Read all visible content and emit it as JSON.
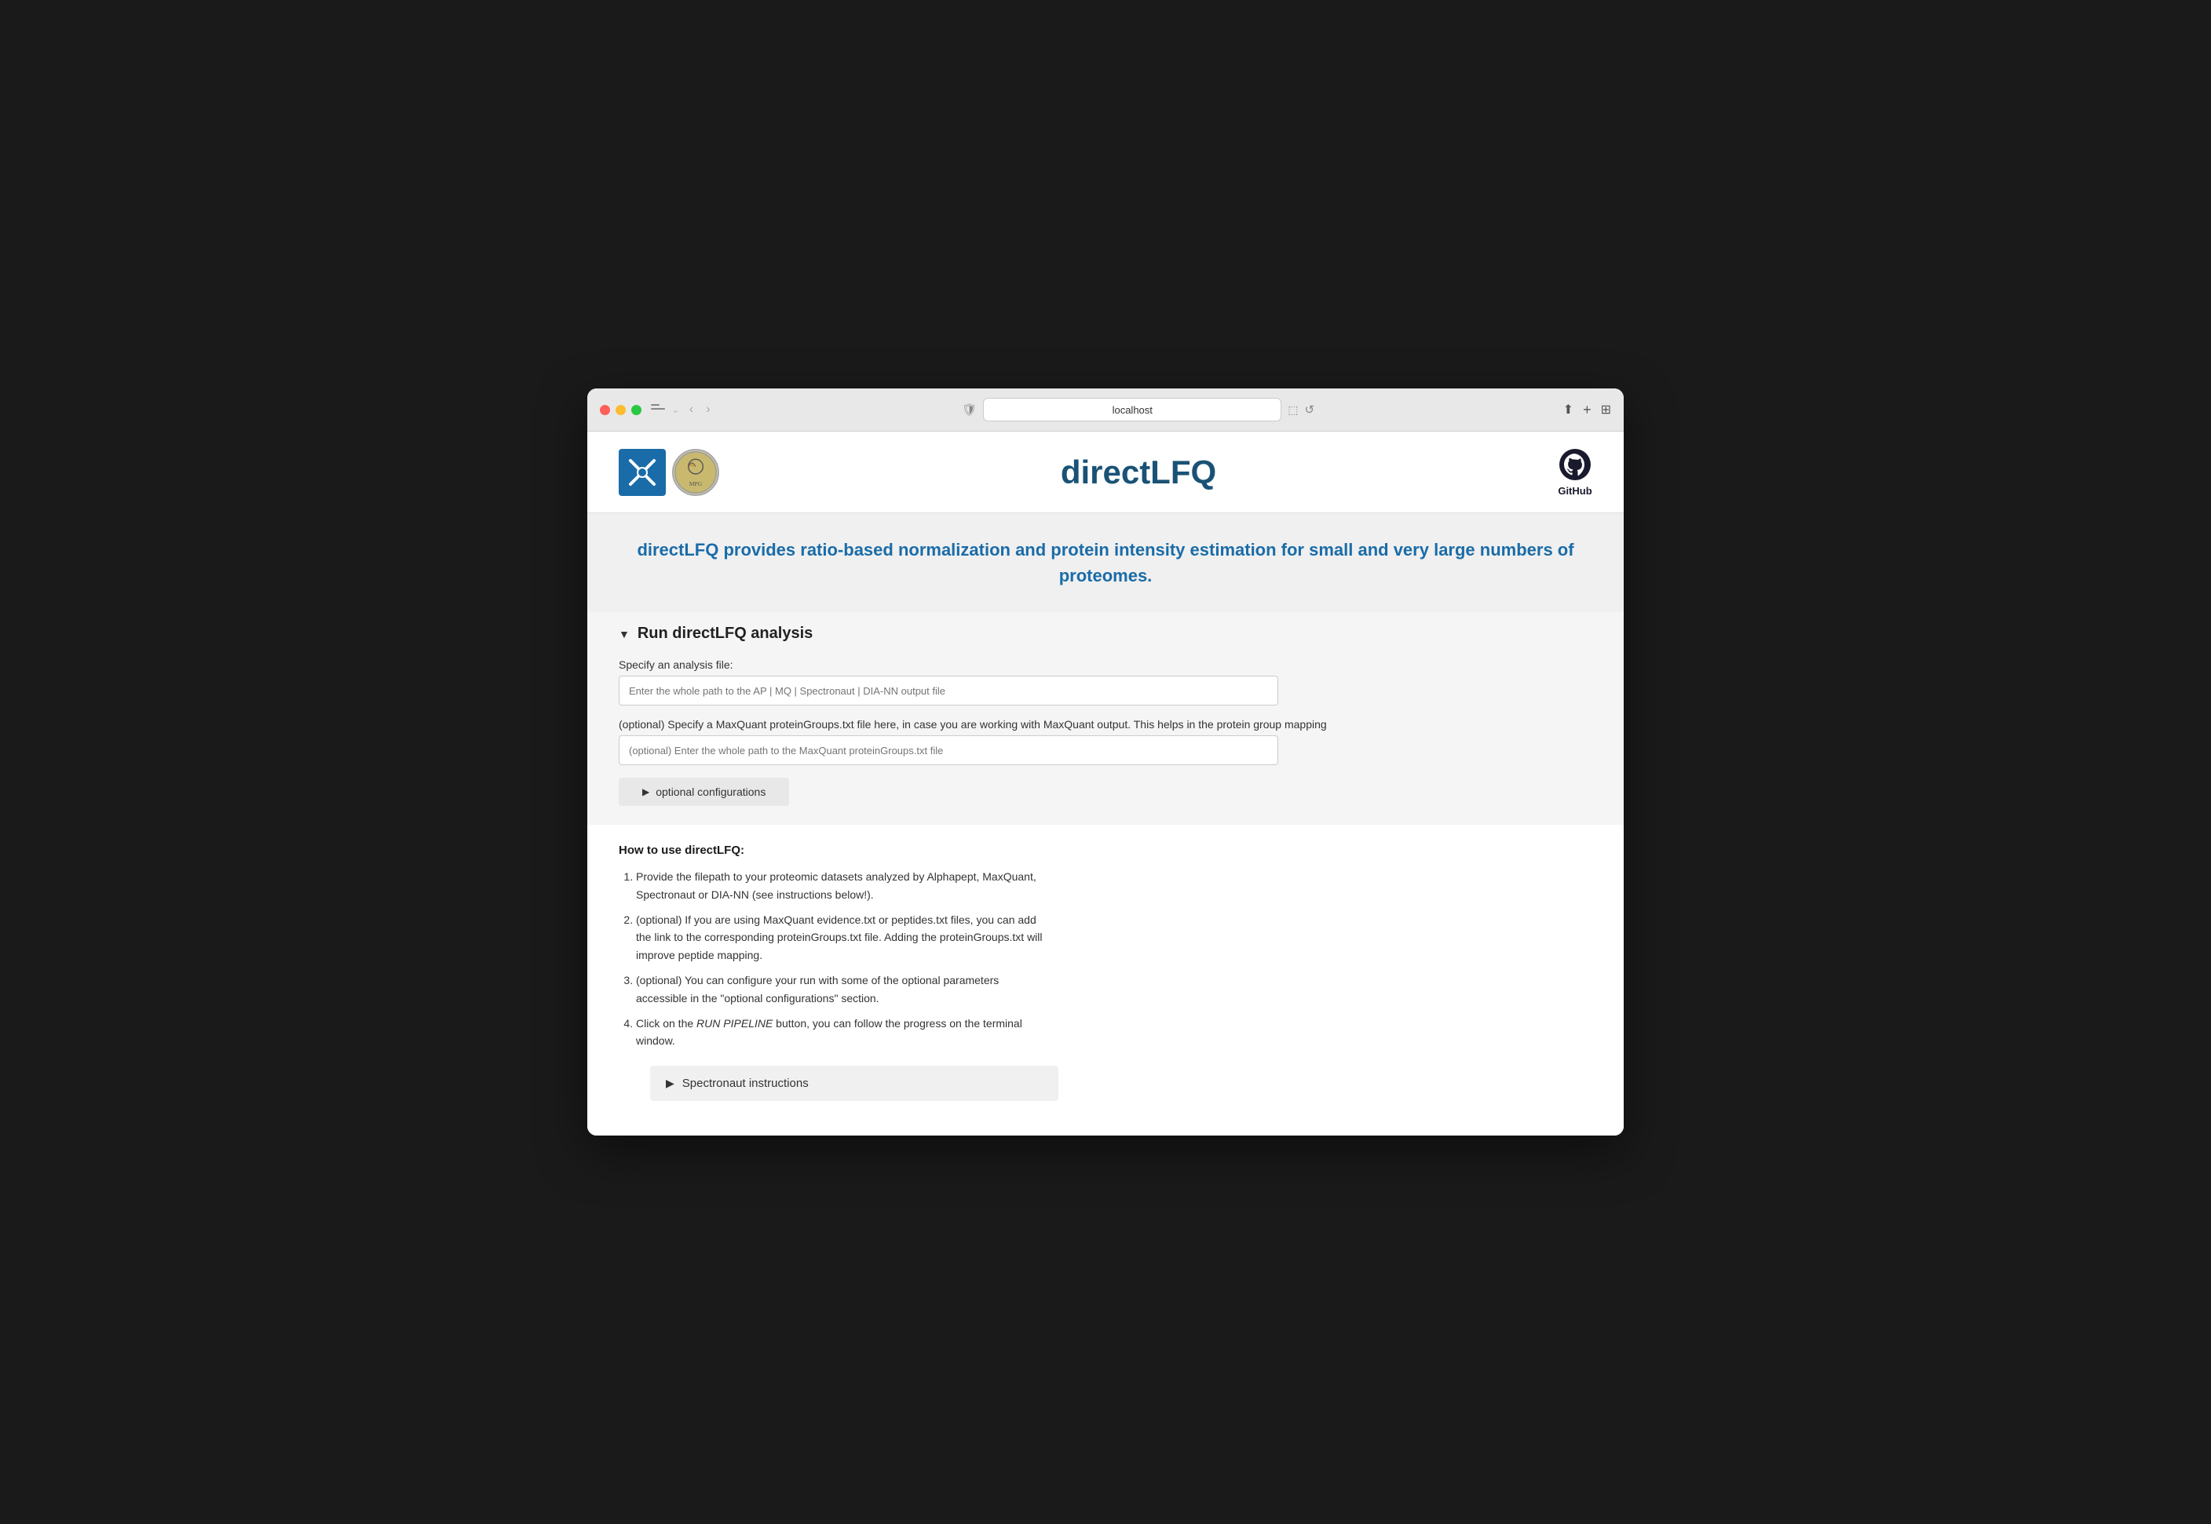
{
  "browser": {
    "url": "localhost",
    "shield_icon": "🛡",
    "refresh_icon": "↺"
  },
  "header": {
    "app_title": "directLFQ",
    "github_label": "GitHub"
  },
  "hero": {
    "text": "directLFQ provides ratio-based normalization and protein intensity estimation for small and very large numbers of proteomes."
  },
  "run_section": {
    "title": "Run directLFQ analysis",
    "collapse_icon": "▼",
    "analysis_file_label": "Specify an analysis file:",
    "analysis_file_placeholder": "Enter the whole path to the AP | MQ | Spectronaut | DIA-NN output file",
    "optional_file_label": "(optional) Specify a MaxQuant proteinGroups.txt file here, in case you are working with MaxQuant output. This helps in the protein group mapping",
    "optional_file_placeholder": "(optional) Enter the whole path to the MaxQuant proteinGroups.txt file",
    "optional_config_btn": "optional configurations",
    "optional_config_arrow": "▶"
  },
  "instructions": {
    "title": "How to use directLFQ:",
    "steps": [
      "Provide the filepath to your proteomic datasets analyzed by Alphapept, MaxQuant, Spectronaut or DIA-NN (see instructions below!).",
      "(optional) If you are using MaxQuant evidence.txt or peptides.txt files, you can add the link to the corresponding proteinGroups.txt file. Adding the proteinGroups.txt will improve peptide mapping.",
      "(optional) You can configure your run with some of the optional parameters accessible in the \"optional configurations\" section.",
      "Click on the RUN PIPELINE button, you can follow the progress on the terminal window."
    ]
  },
  "spectronaut": {
    "title": "Spectronaut instructions",
    "arrow": "▶"
  }
}
